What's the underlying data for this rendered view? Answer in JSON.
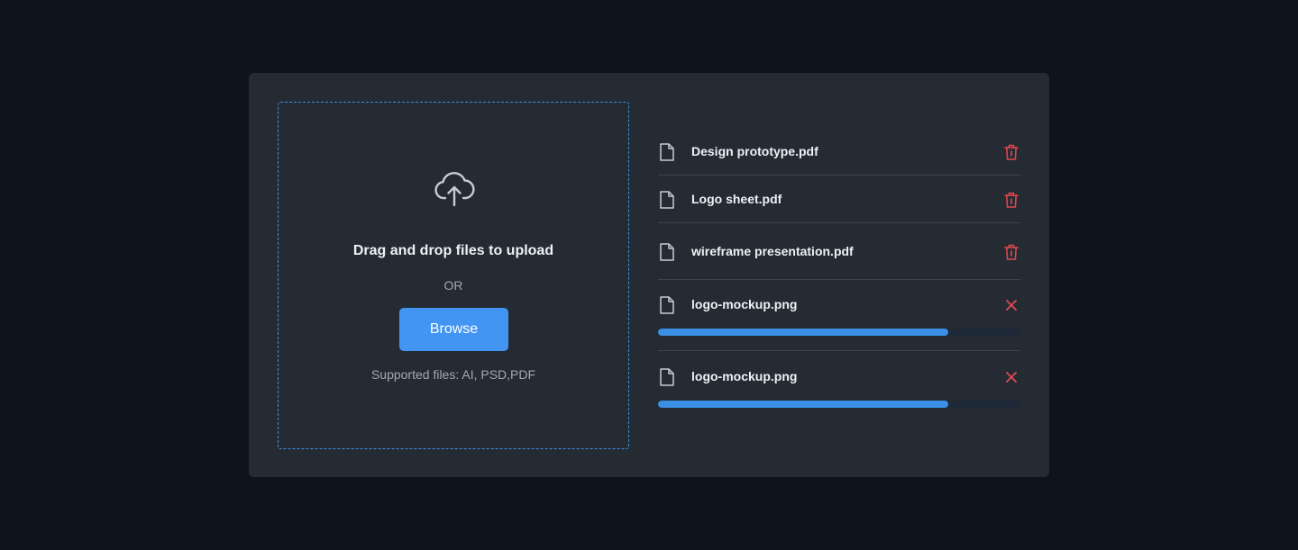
{
  "dropzone": {
    "title": "Drag and drop files to upload",
    "or_text": "OR",
    "browse_label": "Browse",
    "supported_text": "Supported files: AI, PSD,PDF"
  },
  "files": [
    {
      "name": "Design prototype.pdf",
      "action": "delete",
      "action_icon": "trash-icon"
    },
    {
      "name": "Logo sheet.pdf",
      "action": "delete",
      "action_icon": "trash-icon"
    },
    {
      "name": "wireframe presentation.pdf",
      "action": "delete",
      "action_icon": "trash-icon"
    },
    {
      "name": "logo-mockup.png",
      "action": "cancel",
      "action_icon": "close-icon",
      "progress": 0.8
    },
    {
      "name": "logo-mockup.png",
      "action": "cancel",
      "action_icon": "close-icon",
      "progress": 0.8
    }
  ],
  "colors": {
    "page_bg": "#0e131c",
    "card_bg": "#252b33",
    "accent": "#4295f2",
    "danger": "#e5484d",
    "text": "#eef1f5",
    "muted": "#a2a9b3"
  }
}
